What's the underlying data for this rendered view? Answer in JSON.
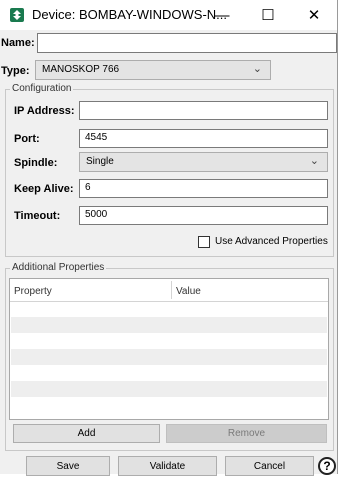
{
  "window": {
    "title": "Device: BOMBAY-WINDOWS-N...",
    "controls": {
      "minimize": "—",
      "maximize": "☐",
      "close": "✕"
    }
  },
  "form": {
    "name_label": "Name:",
    "name_value": "",
    "type_label": "Type:",
    "type_value": "MANOSKOP 766"
  },
  "configuration": {
    "legend": "Configuration",
    "ip_label": "IP Address:",
    "ip_value": "",
    "port_label": "Port:",
    "port_value": "4545",
    "spindle_label": "Spindle:",
    "spindle_value": "Single",
    "keepalive_label": "Keep Alive:",
    "keepalive_value": "6",
    "timeout_label": "Timeout:",
    "timeout_value": "5000",
    "advanced_label": "Use Advanced Properties",
    "advanced_checked": false
  },
  "additional": {
    "legend": "Additional Properties",
    "columns": [
      "Property",
      "Value"
    ],
    "rows": [],
    "add_label": "Add",
    "remove_label": "Remove"
  },
  "footer": {
    "save_label": "Save",
    "validate_label": "Validate",
    "cancel_label": "Cancel",
    "help_glyph": "?"
  }
}
